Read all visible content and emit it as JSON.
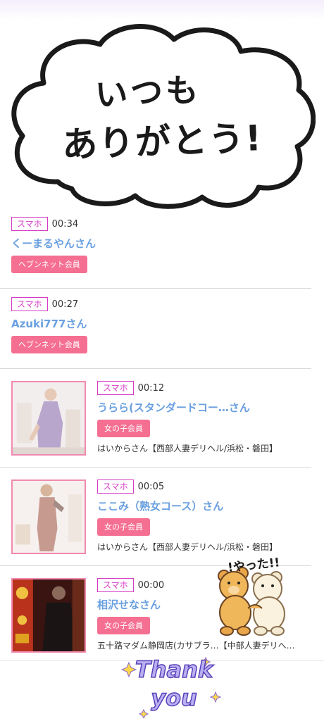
{
  "header_sticker": {
    "line1": "いつも",
    "line2": "ありがとう!"
  },
  "entries": [
    {
      "device": "スマホ",
      "time": "00:34",
      "name": "くーまるやんさん",
      "member": "ヘブンネット会員"
    },
    {
      "device": "スマホ",
      "time": "00:27",
      "name": "Azuki777さん",
      "member": "ヘブンネット会員"
    },
    {
      "device": "スマホ",
      "time": "00:12",
      "name": "うらら(スタンダードコー…さん",
      "member": "女の子会員",
      "shop": "はいからさん【西部人妻デリヘル/浜松・磐田】"
    },
    {
      "device": "スマホ",
      "time": "00:05",
      "name": "ここみ（熟女コース）さん",
      "member": "女の子会員",
      "shop": "はいからさん【西部人妻デリヘル/浜松・磐田】"
    },
    {
      "device": "スマホ",
      "time": "00:00",
      "name": "相沢せなさん",
      "member": "女の子会員",
      "shop": "五十路マダム静岡店(カサブラ…【中部人妻デリへ…"
    }
  ],
  "bear_sticker": {
    "text": "!やった!!"
  },
  "thank_you": {
    "line1": "Thank",
    "line2": "you"
  },
  "colors": {
    "device_badge": "#d63cc7",
    "member_badge": "#f46f91",
    "name_link": "#6aa0e0",
    "photo_border": "#f28ab0"
  },
  "icons": [
    "cloud-sticker-icon",
    "bears-hug-icon",
    "thank-you-sticker-icon"
  ]
}
